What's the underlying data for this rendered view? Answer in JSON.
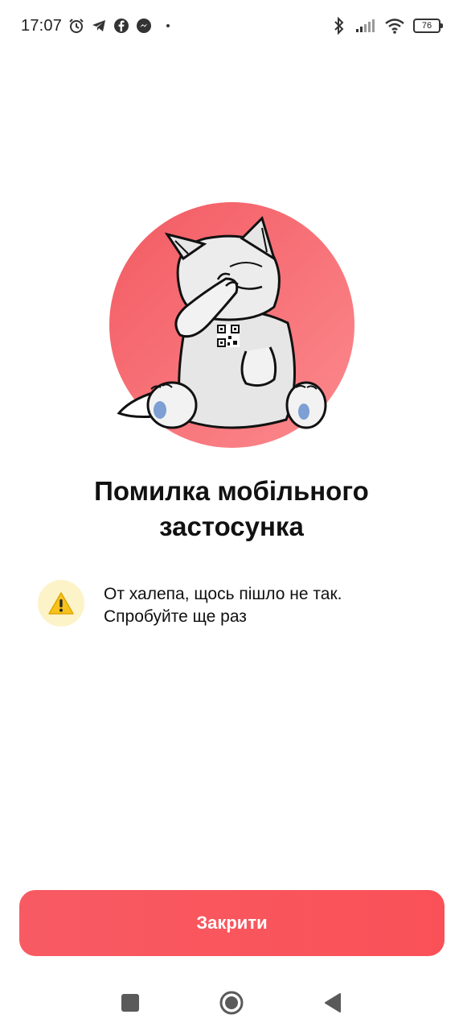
{
  "status_bar": {
    "time": "17:07",
    "battery": "76",
    "left_icons": [
      "alarm-icon",
      "telegram-icon",
      "facebook-icon",
      "messenger-icon"
    ],
    "right_icons": [
      "bluetooth-icon",
      "signal-icon",
      "wifi-icon",
      "battery-icon"
    ]
  },
  "error": {
    "title_line1": "Помилка мобільного",
    "title_line2": "застосунка",
    "message_line1": "От халепа, щось пішло не так.",
    "message_line2": "Спробуйте ще раз",
    "icon": "warning-icon"
  },
  "actions": {
    "close_label": "Закрити"
  },
  "nav_bar": {
    "buttons": [
      "recents-icon",
      "home-icon",
      "back-icon"
    ]
  },
  "colors": {
    "accent": "#fa5158",
    "circle_bg": "#f76d73",
    "warning_bg": "#fdf3c9",
    "paw_pad": "#7d9fd3"
  }
}
